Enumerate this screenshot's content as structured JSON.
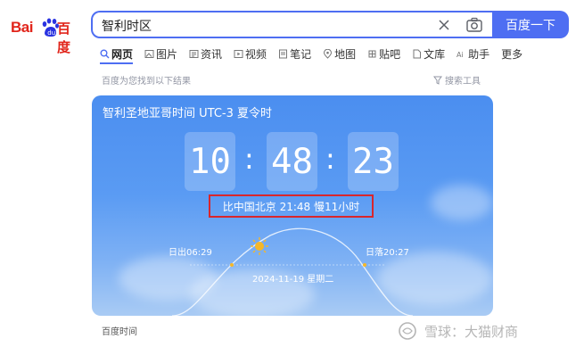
{
  "logo": {
    "bai": "Bai",
    "du_text": "百度"
  },
  "search": {
    "query": "智利时区",
    "button_label": "百度一下"
  },
  "tabs": [
    {
      "label": "网页",
      "icon": "search-icon"
    },
    {
      "label": "图片",
      "icon": "image-icon"
    },
    {
      "label": "资讯",
      "icon": "news-icon"
    },
    {
      "label": "视频",
      "icon": "video-icon"
    },
    {
      "label": "笔记",
      "icon": "note-icon"
    },
    {
      "label": "地图",
      "icon": "map-pin-icon"
    },
    {
      "label": "贴吧",
      "icon": "tieba-icon"
    },
    {
      "label": "文库",
      "icon": "doc-icon"
    },
    {
      "label": "助手",
      "icon": "ai-icon"
    },
    {
      "label": "更多",
      "icon": ""
    }
  ],
  "results": {
    "hint": "百度为您找到以下结果",
    "tools_label": "搜索工具"
  },
  "card": {
    "title": "智利圣地亚哥时间 UTC-3 夏令时",
    "time": {
      "h": "10",
      "m": "48",
      "s": "23",
      "separator": ":"
    },
    "diff_text": "比中国北京 21:48 慢11小时",
    "sunrise": "日出06:29",
    "sunset": "日落20:27",
    "date": "2024-11-19  星期二",
    "sun_progress": 0.31
  },
  "footer": {
    "source": "百度时间"
  },
  "watermark": {
    "text": "雪球：大猫财商"
  },
  "colors": {
    "accent": "#4e6ef2",
    "brand_red": "#e1251b",
    "highlight_border": "#d9262c",
    "sun": "#f5b729"
  }
}
